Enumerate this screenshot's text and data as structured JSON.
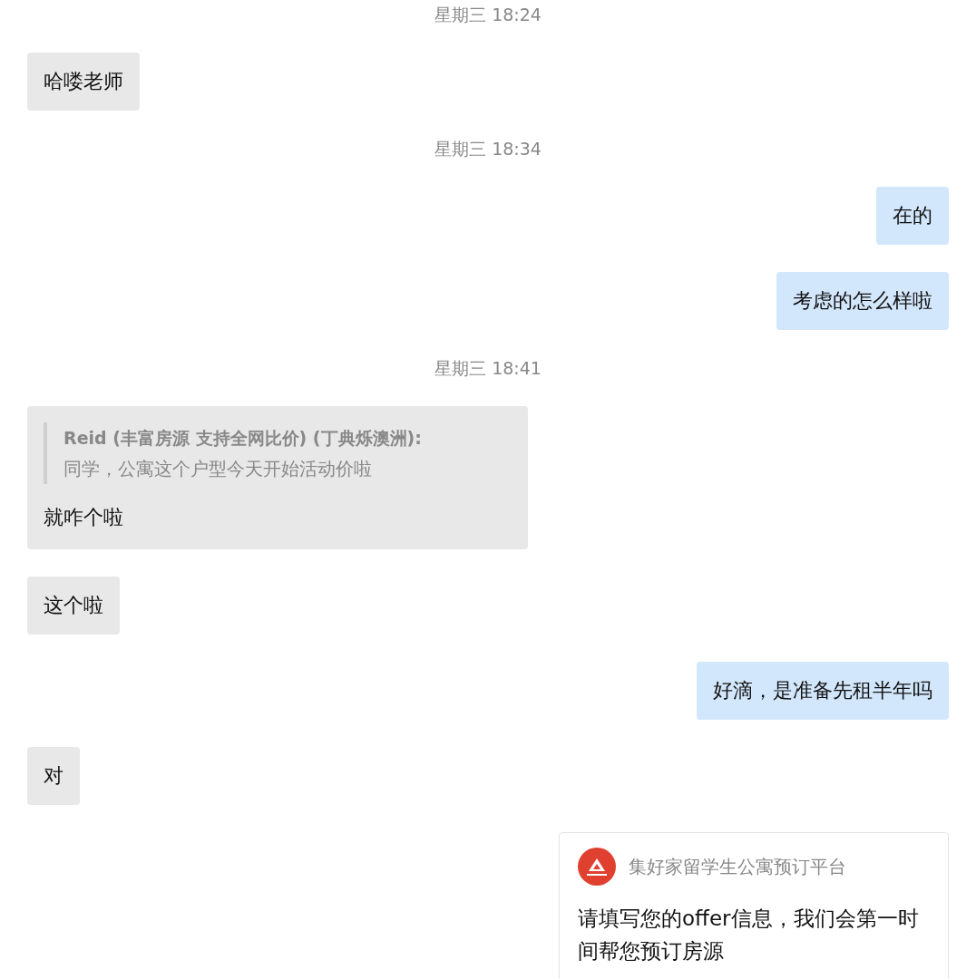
{
  "messages": [
    {
      "kind": "time",
      "text": "星期三 18:24"
    },
    {
      "kind": "in",
      "text": "哈喽老师"
    },
    {
      "kind": "time",
      "text": "星期三 18:34"
    },
    {
      "kind": "out",
      "text": "在的"
    },
    {
      "kind": "out",
      "text": "考虑的怎么样啦"
    },
    {
      "kind": "time",
      "text": "星期三 18:41"
    },
    {
      "kind": "quote",
      "quote_author": "Reid (丰富房源 支持全网比价) (丁典烁澳洲):",
      "quote_text": "同学，公寓这个户型今天开始活动价啦",
      "text": "就咋个啦"
    },
    {
      "kind": "in",
      "text": "这个啦"
    },
    {
      "kind": "out",
      "text": "好滴，是准备先租半年吗"
    },
    {
      "kind": "in",
      "text": "对"
    },
    {
      "kind": "card",
      "title": "集好家留学生公寓预订平台",
      "text": "请填写您的offer信息，我们会第一时间帮您预订房源"
    }
  ]
}
